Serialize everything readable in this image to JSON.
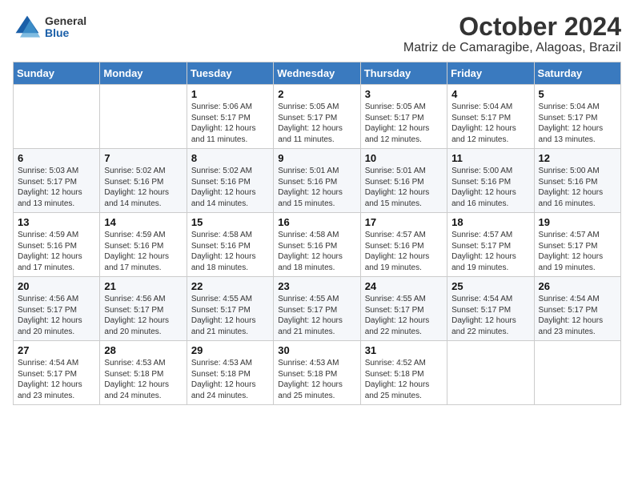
{
  "header": {
    "logo": {
      "general": "General",
      "blue": "Blue"
    },
    "title": "October 2024",
    "subtitle": "Matriz de Camaragibe, Alagoas, Brazil"
  },
  "weekdays": [
    "Sunday",
    "Monday",
    "Tuesday",
    "Wednesday",
    "Thursday",
    "Friday",
    "Saturday"
  ],
  "weeks": [
    [
      {
        "day": "",
        "info": ""
      },
      {
        "day": "",
        "info": ""
      },
      {
        "day": "1",
        "info": "Sunrise: 5:06 AM\nSunset: 5:17 PM\nDaylight: 12 hours and 11 minutes."
      },
      {
        "day": "2",
        "info": "Sunrise: 5:05 AM\nSunset: 5:17 PM\nDaylight: 12 hours and 11 minutes."
      },
      {
        "day": "3",
        "info": "Sunrise: 5:05 AM\nSunset: 5:17 PM\nDaylight: 12 hours and 12 minutes."
      },
      {
        "day": "4",
        "info": "Sunrise: 5:04 AM\nSunset: 5:17 PM\nDaylight: 12 hours and 12 minutes."
      },
      {
        "day": "5",
        "info": "Sunrise: 5:04 AM\nSunset: 5:17 PM\nDaylight: 12 hours and 13 minutes."
      }
    ],
    [
      {
        "day": "6",
        "info": "Sunrise: 5:03 AM\nSunset: 5:17 PM\nDaylight: 12 hours and 13 minutes."
      },
      {
        "day": "7",
        "info": "Sunrise: 5:02 AM\nSunset: 5:16 PM\nDaylight: 12 hours and 14 minutes."
      },
      {
        "day": "8",
        "info": "Sunrise: 5:02 AM\nSunset: 5:16 PM\nDaylight: 12 hours and 14 minutes."
      },
      {
        "day": "9",
        "info": "Sunrise: 5:01 AM\nSunset: 5:16 PM\nDaylight: 12 hours and 15 minutes."
      },
      {
        "day": "10",
        "info": "Sunrise: 5:01 AM\nSunset: 5:16 PM\nDaylight: 12 hours and 15 minutes."
      },
      {
        "day": "11",
        "info": "Sunrise: 5:00 AM\nSunset: 5:16 PM\nDaylight: 12 hours and 16 minutes."
      },
      {
        "day": "12",
        "info": "Sunrise: 5:00 AM\nSunset: 5:16 PM\nDaylight: 12 hours and 16 minutes."
      }
    ],
    [
      {
        "day": "13",
        "info": "Sunrise: 4:59 AM\nSunset: 5:16 PM\nDaylight: 12 hours and 17 minutes."
      },
      {
        "day": "14",
        "info": "Sunrise: 4:59 AM\nSunset: 5:16 PM\nDaylight: 12 hours and 17 minutes."
      },
      {
        "day": "15",
        "info": "Sunrise: 4:58 AM\nSunset: 5:16 PM\nDaylight: 12 hours and 18 minutes."
      },
      {
        "day": "16",
        "info": "Sunrise: 4:58 AM\nSunset: 5:16 PM\nDaylight: 12 hours and 18 minutes."
      },
      {
        "day": "17",
        "info": "Sunrise: 4:57 AM\nSunset: 5:16 PM\nDaylight: 12 hours and 19 minutes."
      },
      {
        "day": "18",
        "info": "Sunrise: 4:57 AM\nSunset: 5:17 PM\nDaylight: 12 hours and 19 minutes."
      },
      {
        "day": "19",
        "info": "Sunrise: 4:57 AM\nSunset: 5:17 PM\nDaylight: 12 hours and 19 minutes."
      }
    ],
    [
      {
        "day": "20",
        "info": "Sunrise: 4:56 AM\nSunset: 5:17 PM\nDaylight: 12 hours and 20 minutes."
      },
      {
        "day": "21",
        "info": "Sunrise: 4:56 AM\nSunset: 5:17 PM\nDaylight: 12 hours and 20 minutes."
      },
      {
        "day": "22",
        "info": "Sunrise: 4:55 AM\nSunset: 5:17 PM\nDaylight: 12 hours and 21 minutes."
      },
      {
        "day": "23",
        "info": "Sunrise: 4:55 AM\nSunset: 5:17 PM\nDaylight: 12 hours and 21 minutes."
      },
      {
        "day": "24",
        "info": "Sunrise: 4:55 AM\nSunset: 5:17 PM\nDaylight: 12 hours and 22 minutes."
      },
      {
        "day": "25",
        "info": "Sunrise: 4:54 AM\nSunset: 5:17 PM\nDaylight: 12 hours and 22 minutes."
      },
      {
        "day": "26",
        "info": "Sunrise: 4:54 AM\nSunset: 5:17 PM\nDaylight: 12 hours and 23 minutes."
      }
    ],
    [
      {
        "day": "27",
        "info": "Sunrise: 4:54 AM\nSunset: 5:17 PM\nDaylight: 12 hours and 23 minutes."
      },
      {
        "day": "28",
        "info": "Sunrise: 4:53 AM\nSunset: 5:18 PM\nDaylight: 12 hours and 24 minutes."
      },
      {
        "day": "29",
        "info": "Sunrise: 4:53 AM\nSunset: 5:18 PM\nDaylight: 12 hours and 24 minutes."
      },
      {
        "day": "30",
        "info": "Sunrise: 4:53 AM\nSunset: 5:18 PM\nDaylight: 12 hours and 25 minutes."
      },
      {
        "day": "31",
        "info": "Sunrise: 4:52 AM\nSunset: 5:18 PM\nDaylight: 12 hours and 25 minutes."
      },
      {
        "day": "",
        "info": ""
      },
      {
        "day": "",
        "info": ""
      }
    ]
  ]
}
